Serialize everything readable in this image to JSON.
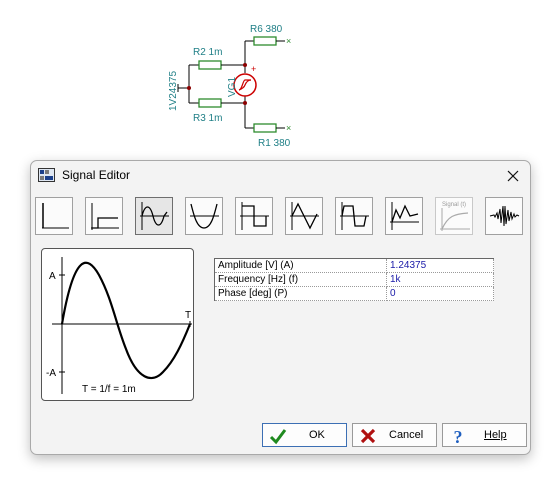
{
  "schematic": {
    "r6_label": "R6 380",
    "r2_label": "R2 1m",
    "r3_label": "R3 1m",
    "r1_label": "R1 380",
    "source_label": "VG1",
    "node_label": "1V24375",
    "plus_sign": "+"
  },
  "dialog": {
    "title": "Signal Editor",
    "toolbar": [
      {
        "name": "unit-step",
        "label": ""
      },
      {
        "name": "step",
        "label": ""
      },
      {
        "name": "sine",
        "label": ""
      },
      {
        "name": "cosine",
        "label": ""
      },
      {
        "name": "square",
        "label": ""
      },
      {
        "name": "triangle",
        "label": ""
      },
      {
        "name": "trapezoid",
        "label": ""
      },
      {
        "name": "general",
        "label": ""
      },
      {
        "name": "signal-t",
        "label": "Signal (t)"
      },
      {
        "name": "noise",
        "label": ""
      }
    ],
    "selected_tool": "sine",
    "preview": {
      "amp_label": "A",
      "neg_amp_label": "-A",
      "t_label": "T",
      "formula": "T = 1/f = 1m"
    },
    "params": [
      {
        "name": "Amplitude [V] (A)",
        "value": "1.24375"
      },
      {
        "name": "Frequency [Hz] (f)",
        "value": "1k"
      },
      {
        "name": "Phase [deg] (P)",
        "value": "0"
      }
    ],
    "buttons": {
      "ok": "OK",
      "cancel": "Cancel",
      "help": "Help"
    }
  },
  "colors": {
    "schematic_label": "#1f7f86",
    "resistor": "#2e8b2e",
    "source": "#cc0000",
    "value_text": "#1a1aa8"
  }
}
